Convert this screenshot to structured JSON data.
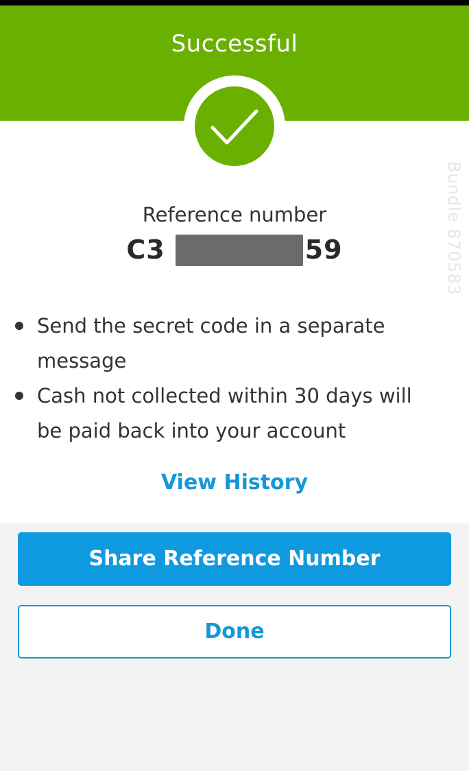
{
  "header": {
    "title": "Successful"
  },
  "watermark": "Bundle 870583",
  "reference": {
    "label": "Reference number",
    "prefix": "C3",
    "suffix": "59"
  },
  "bullets": [
    "Send the secret code in a separate message",
    "Cash not collected within 30 days will be paid back into your account"
  ],
  "links": {
    "view_history": "View History"
  },
  "buttons": {
    "share": "Share Reference Number",
    "done": "Done"
  },
  "colors": {
    "success": "#6ab000",
    "accent": "#0f9ae0"
  },
  "icons": {
    "status": "checkmark-icon"
  }
}
